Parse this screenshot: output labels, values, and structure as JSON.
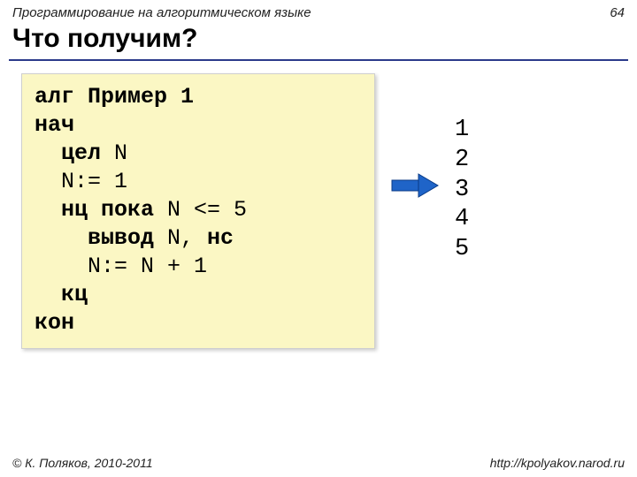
{
  "header": {
    "topic": "Программирование на алгоритмическом языке",
    "page_number": "64"
  },
  "title": "Что получим?",
  "code": {
    "l1a": "алг ",
    "l1b": "Пример 1",
    "l2": "нач",
    "l3a": "  цел",
    "l3b": " N",
    "l4": "  N:= 1",
    "l5a": "  нц пока",
    "l5b": " N <= 5",
    "l6a": "    вывод",
    "l6b": " N, ",
    "l6c": "нс",
    "l7": "    N:= N + 1",
    "l8": "  кц",
    "l9": "кон"
  },
  "output": {
    "l1": "1",
    "l2": "2",
    "l3": "3",
    "l4": "4",
    "l5": "5"
  },
  "footer": {
    "copyright": "© К. Поляков, 2010-2011",
    "url": "http://kpolyakov.narod.ru"
  }
}
